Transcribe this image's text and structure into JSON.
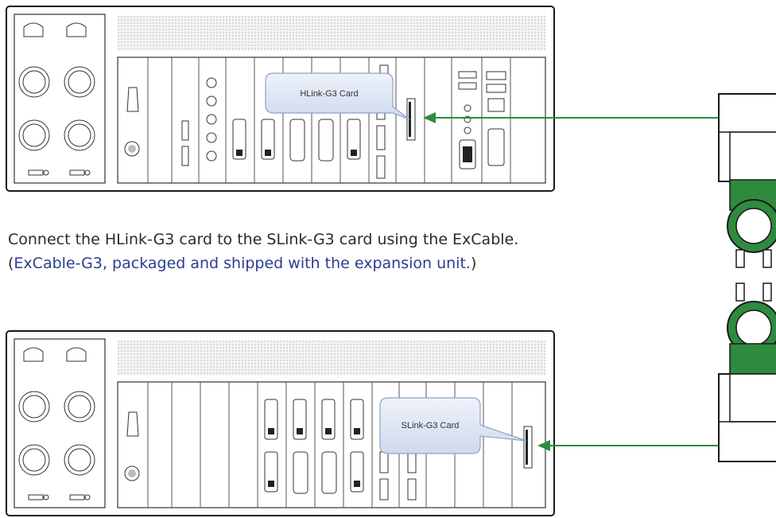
{
  "callouts": {
    "host_card": "HLink-G3 Card",
    "target_card": "SLink-G3 Card"
  },
  "instructions": {
    "line1": "Connect the HLink-G3 card to the SLink-G3 card using the ExCable.",
    "line2_open": "(",
    "line2_text": "ExCable-G3, packaged and shipped with the expansion unit.",
    "line2_close": ")"
  },
  "colors": {
    "arrow": "#2e8b3e",
    "cable_clip": "#2e8b3e",
    "outline": "#1a1a1a",
    "callout_fill": "#dfe7f5",
    "text_blue": "#2b3d8f"
  }
}
